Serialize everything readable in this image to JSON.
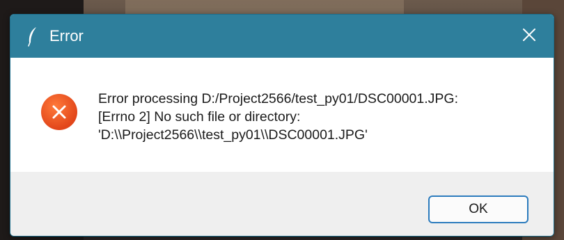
{
  "window": {
    "title": "Error",
    "icon": "feather-icon",
    "close_icon": "close-icon"
  },
  "message": {
    "icon": "error-x-circle-icon",
    "lines": [
      "Error processing D:/Project2566/test_py01/DSC00001.JPG:",
      "[Errno 2] No such file or directory:",
      "'D:\\\\Project2566\\\\test_py01\\\\DSC00001.JPG'"
    ]
  },
  "buttons": {
    "ok_label": "OK"
  },
  "colors": {
    "titlebar": "#2e7f9c",
    "error_icon": "#e8501e",
    "button_border": "#2b7bbd"
  }
}
